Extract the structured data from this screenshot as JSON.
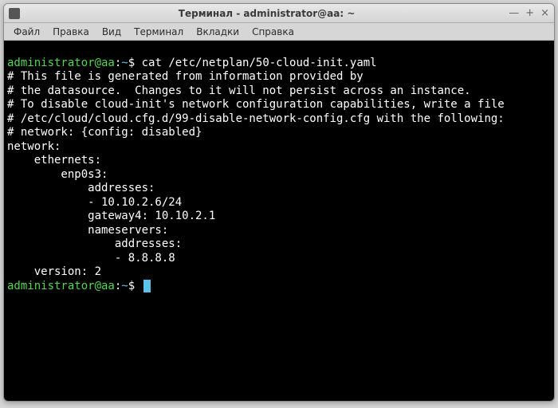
{
  "window": {
    "title": "Терминал - administrator@aa: ~"
  },
  "menu": {
    "file": "Файл",
    "edit": "Правка",
    "view": "Вид",
    "terminal": "Терминал",
    "tabs": "Вкладки",
    "help": "Справка"
  },
  "term": {
    "prompt1_user": "administrator@aa",
    "prompt1_sep": ":",
    "prompt1_path": "~",
    "prompt1_sym": "$",
    "command1": "cat /etc/netplan/50-cloud-init.yaml",
    "out": {
      "l1": "# This file is generated from information provided by",
      "l2": "# the datasource.  Changes to it will not persist across an instance.",
      "l3": "# To disable cloud-init's network configuration capabilities, write a file",
      "l4": "# /etc/cloud/cloud.cfg.d/99-disable-network-config.cfg with the following:",
      "l5": "# network: {config: disabled}",
      "l6": "network:",
      "l7": "    ethernets:",
      "l8": "        enp0s3:",
      "l9": "            addresses:",
      "l10": "            - 10.10.2.6/24",
      "l11": "            gateway4: 10.10.2.1",
      "l12": "            nameservers:",
      "l13": "                addresses:",
      "l14": "                - 8.8.8.8",
      "l15": "    version: 2"
    },
    "prompt2_user": "administrator@aa",
    "prompt2_sep": ":",
    "prompt2_path": "~",
    "prompt2_sym": "$"
  }
}
